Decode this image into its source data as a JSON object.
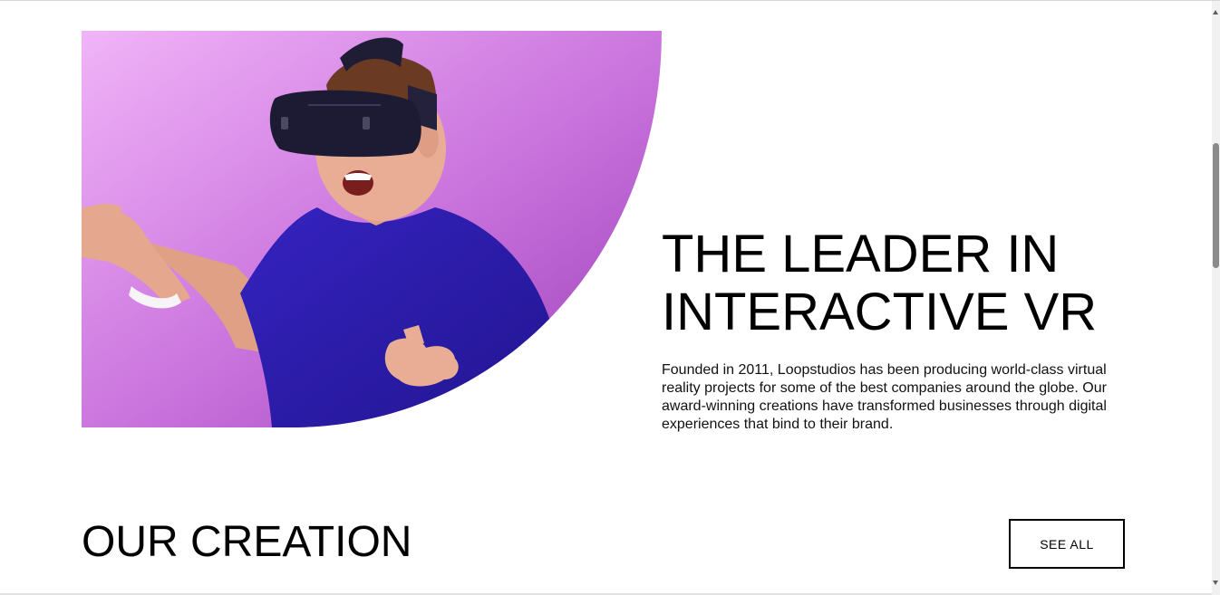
{
  "hero": {
    "title": "THE LEADER IN INTERACTIVE VR",
    "body": "Founded in 2011, Loopstudios has been producing world-class virtual reality projects for some of the best companies around the globe. Our award-winning creations have transformed businesses through digital experiences that bind to their brand.",
    "image_subject": "man-wearing-vr-headset",
    "colors": {
      "background_light": "#ecaaf6",
      "background_dark": "#a94ec4",
      "shirt": "#2a1aa6",
      "headset": "#1d1b33",
      "skin": "#e7a791"
    }
  },
  "creations": {
    "title": "OUR CREATION",
    "see_all_label": "SEE ALL"
  },
  "scrollbar": {
    "position_fraction": 0.24
  }
}
